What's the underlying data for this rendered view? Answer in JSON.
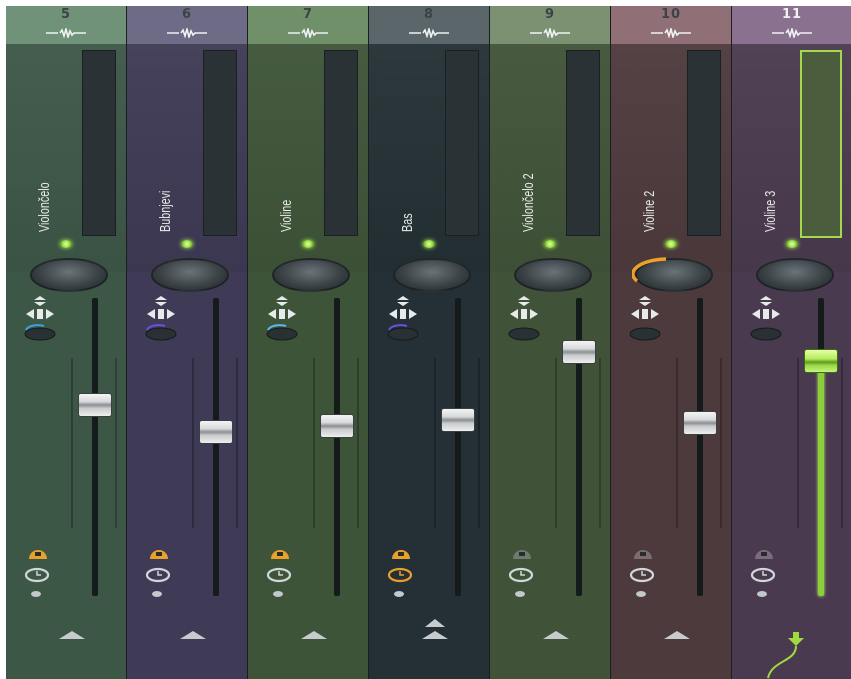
{
  "mixer": {
    "strips": [
      {
        "number": "5",
        "name": "Violončelo",
        "color": "#3d5747",
        "head": "#6f9278",
        "pan_arc_color": "#3ca0e0",
        "routing_color": "#e8a12b",
        "send_color": "#d1d7d9",
        "arrow_double": false,
        "routing_active": true,
        "send_active": false
      },
      {
        "number": "6",
        "name": "Bubnjevi",
        "color": "#3f3a55",
        "head": "#6d6b86",
        "pan_arc_color": "#6a4fe2",
        "routing_color": "#e8a12b",
        "send_color": "#d1d7d9",
        "arrow_double": false,
        "routing_active": true,
        "send_active": false
      },
      {
        "number": "7",
        "name": "Violine",
        "color": "#3e5438",
        "head": "#70906a",
        "pan_arc_color": "#58b8f0",
        "routing_color": "#e8a12b",
        "send_color": "#d1d7d9",
        "arrow_double": false,
        "routing_active": true,
        "send_active": false
      },
      {
        "number": "8",
        "name": "Bas",
        "color": "#243035",
        "head": "#5b666a",
        "pan_arc_color": "#6a4fe2",
        "routing_color": "#e8a12b",
        "send_color": "#e8a12b",
        "arrow_double": true,
        "routing_active": true,
        "send_active": true
      },
      {
        "number": "9",
        "name": "Violončelo 2",
        "color": "#405338",
        "head": "#7c9172",
        "pan_arc_color": "",
        "routing_color": "#6c7a70",
        "send_color": "#d1d7d9",
        "arrow_double": false,
        "routing_active": false,
        "send_active": false
      },
      {
        "number": "10",
        "name": "Violine 2",
        "color": "#4d3a3d",
        "head": "#907076",
        "pan_arc_color": "",
        "routing_color": "#7a6c70",
        "send_color": "#d1d7d9",
        "arrow_double": false,
        "routing_active": false,
        "send_active": false
      },
      {
        "number": "11",
        "name": "Violine 3",
        "color": "#4a3a4f",
        "head": "#8a7190",
        "pan_arc_color": "",
        "routing_color": "#7a6c80",
        "send_color": "#d1d7d9",
        "arrow_double": false,
        "routing_active": false,
        "send_active": false
      }
    ],
    "fader_levels": [
      0.64,
      0.55,
      0.57,
      0.59,
      0.82,
      0.58,
      0.79
    ],
    "volume_knob_fraction": [
      0,
      0,
      0,
      0,
      0,
      0.28,
      0
    ],
    "selected_strip": "11",
    "accent_green": "#9fdb3f"
  }
}
